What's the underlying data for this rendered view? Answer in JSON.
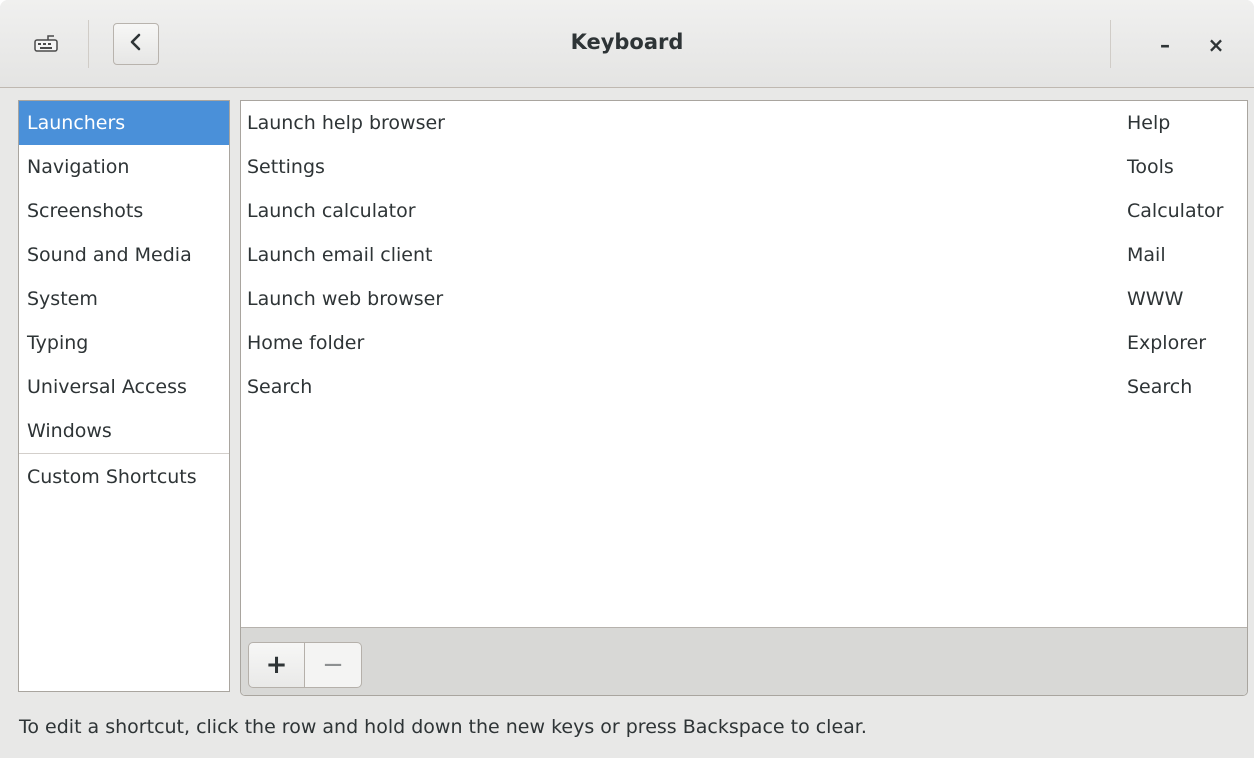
{
  "window": {
    "title": "Keyboard",
    "app_icon": "keyboard-icon",
    "back_icon": "chevron-left-icon",
    "minimize_label": "–",
    "close_label": "×"
  },
  "sidebar": {
    "selected_color": "#4a90d9",
    "items": [
      {
        "label": "Launchers",
        "selected": true
      },
      {
        "label": "Navigation"
      },
      {
        "label": "Screenshots"
      },
      {
        "label": "Sound and Media"
      },
      {
        "label": "System"
      },
      {
        "label": "Typing"
      },
      {
        "label": "Universal Access"
      },
      {
        "label": "Windows"
      }
    ],
    "custom": {
      "label": "Custom Shortcuts"
    }
  },
  "shortcuts": {
    "rows": [
      {
        "name": "Launch help browser",
        "accel": "Help"
      },
      {
        "name": "Settings",
        "accel": "Tools"
      },
      {
        "name": "Launch calculator",
        "accel": "Calculator"
      },
      {
        "name": "Launch email client",
        "accel": "Mail"
      },
      {
        "name": "Launch web browser",
        "accel": "WWW"
      },
      {
        "name": "Home folder",
        "accel": "Explorer"
      },
      {
        "name": "Search",
        "accel": "Search"
      }
    ],
    "toolbar": {
      "add_label": "+",
      "remove_label": "−"
    }
  },
  "hint": "To edit a shortcut, click the row and hold down the new keys or press Backspace to clear."
}
